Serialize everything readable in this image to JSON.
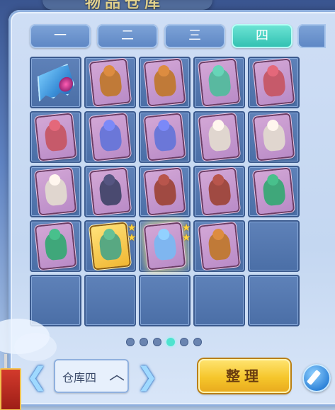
{
  "header": {
    "title": "物品仓库"
  },
  "tabs": [
    {
      "label": "一",
      "active": false
    },
    {
      "label": "二",
      "active": false
    },
    {
      "label": "三",
      "active": false
    },
    {
      "label": "四",
      "active": true
    }
  ],
  "grid": {
    "columns": 5,
    "rows": 5,
    "items": [
      {
        "icon": "fragment-icon",
        "kind": "fragment"
      },
      {
        "icon": "lion-dancer-card-icon",
        "kind": "card",
        "color": "#c07a38"
      },
      {
        "icon": "lion-dancer-card-icon",
        "kind": "card",
        "color": "#c07a38"
      },
      {
        "icon": "fairy-card-icon",
        "kind": "card",
        "color": "#59b9a0"
      },
      {
        "icon": "red-warrior-card-icon",
        "kind": "card",
        "color": "#c65a6a"
      },
      {
        "icon": "red-warrior-card-icon",
        "kind": "card",
        "color": "#c65a6a"
      },
      {
        "icon": "blue-spirit-card-icon",
        "kind": "card",
        "color": "#6b77d8"
      },
      {
        "icon": "blue-spirit-card-icon",
        "kind": "card",
        "color": "#6b77d8"
      },
      {
        "icon": "winged-dancer-card-icon",
        "kind": "card",
        "color": "#e0d6cf"
      },
      {
        "icon": "winged-dancer-card-icon",
        "kind": "card",
        "color": "#e0d6cf"
      },
      {
        "icon": "winged-dancer-card-icon",
        "kind": "card",
        "color": "#e0d6cf"
      },
      {
        "icon": "dark-swordsman-card-icon",
        "kind": "card",
        "color": "#4a4a70"
      },
      {
        "icon": "armored-demon-card-icon",
        "kind": "card",
        "color": "#a04a42"
      },
      {
        "icon": "armored-demon-card-icon",
        "kind": "card",
        "color": "#a04a42"
      },
      {
        "icon": "dragon-card-icon",
        "kind": "card",
        "color": "#3fa77a"
      },
      {
        "icon": "dragon-card-icon",
        "kind": "card",
        "color": "#3fa77a"
      },
      {
        "icon": "golden-fairy-card-icon",
        "kind": "card",
        "color": "#58a882",
        "gold": true,
        "stars": 2
      },
      {
        "icon": "water-spirit-card-icon",
        "kind": "card",
        "color": "#7fb6f0",
        "glow": true,
        "stars": 2
      },
      {
        "icon": "lion-dancer-card-icon",
        "kind": "card",
        "color": "#c07a38"
      },
      {
        "icon": "empty-slot",
        "kind": "empty"
      },
      {
        "icon": "empty-slot",
        "kind": "empty"
      },
      {
        "icon": "empty-slot",
        "kind": "empty"
      },
      {
        "icon": "empty-slot",
        "kind": "empty"
      },
      {
        "icon": "empty-slot",
        "kind": "empty"
      },
      {
        "icon": "empty-slot",
        "kind": "empty"
      }
    ]
  },
  "pagination": {
    "total": 6,
    "current": 4
  },
  "footer": {
    "prev_icon": "left-arrow-icon",
    "next_icon": "right-arrow-icon",
    "warehouse_label": "仓库四",
    "sort_label": "整理",
    "edit_icon": "pencil-icon"
  },
  "colors": {
    "tab_active": "#2fbfb0",
    "tab_inactive": "#5d86c4",
    "sort_button": "#f5c62b",
    "dot_active": "#4fe3cf"
  }
}
